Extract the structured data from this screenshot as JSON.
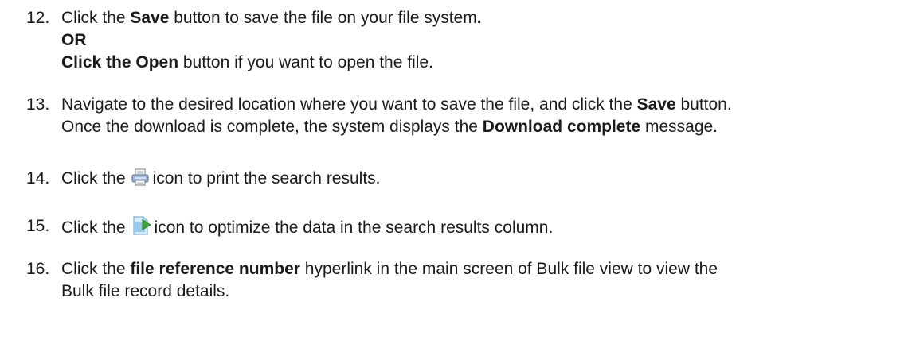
{
  "steps": [
    {
      "number": "12.",
      "line1": {
        "pre": "Click the ",
        "bold": "Save",
        "post": " button to save the file on your file system",
        "tail_bold": "."
      },
      "line2": {
        "bold": "OR"
      },
      "line3": {
        "bold": "Click the Open",
        "post": " button if you want to open the file."
      }
    },
    {
      "number": "13.",
      "line1": {
        "pre": "Navigate to the desired location where you want to save the file, and click the ",
        "bold": "Save",
        "post": " button."
      },
      "line2": {
        "pre": "Once the download is complete, the system displays the ",
        "bold": "Download complete",
        "post": " message."
      }
    },
    {
      "number": "14.",
      "pre": "Click the",
      "icon": "printer-icon",
      "post": "icon to print the search results."
    },
    {
      "number": "15.",
      "pre": "Click the",
      "icon": "optimize-icon",
      "post": "icon to optimize the data in the search results column."
    },
    {
      "number": "16.",
      "line1": {
        "pre": "Click the ",
        "bold": "file reference number",
        "post": " hyperlink in the main screen of Bulk file view to view the"
      },
      "line2": {
        "text": "Bulk file record details."
      }
    }
  ],
  "colors": {
    "text": "#1a1a1a",
    "printer_body": "#9fb7d6",
    "optimize_page": "#9cc8ee",
    "optimize_arrow": "#3fa33a"
  }
}
